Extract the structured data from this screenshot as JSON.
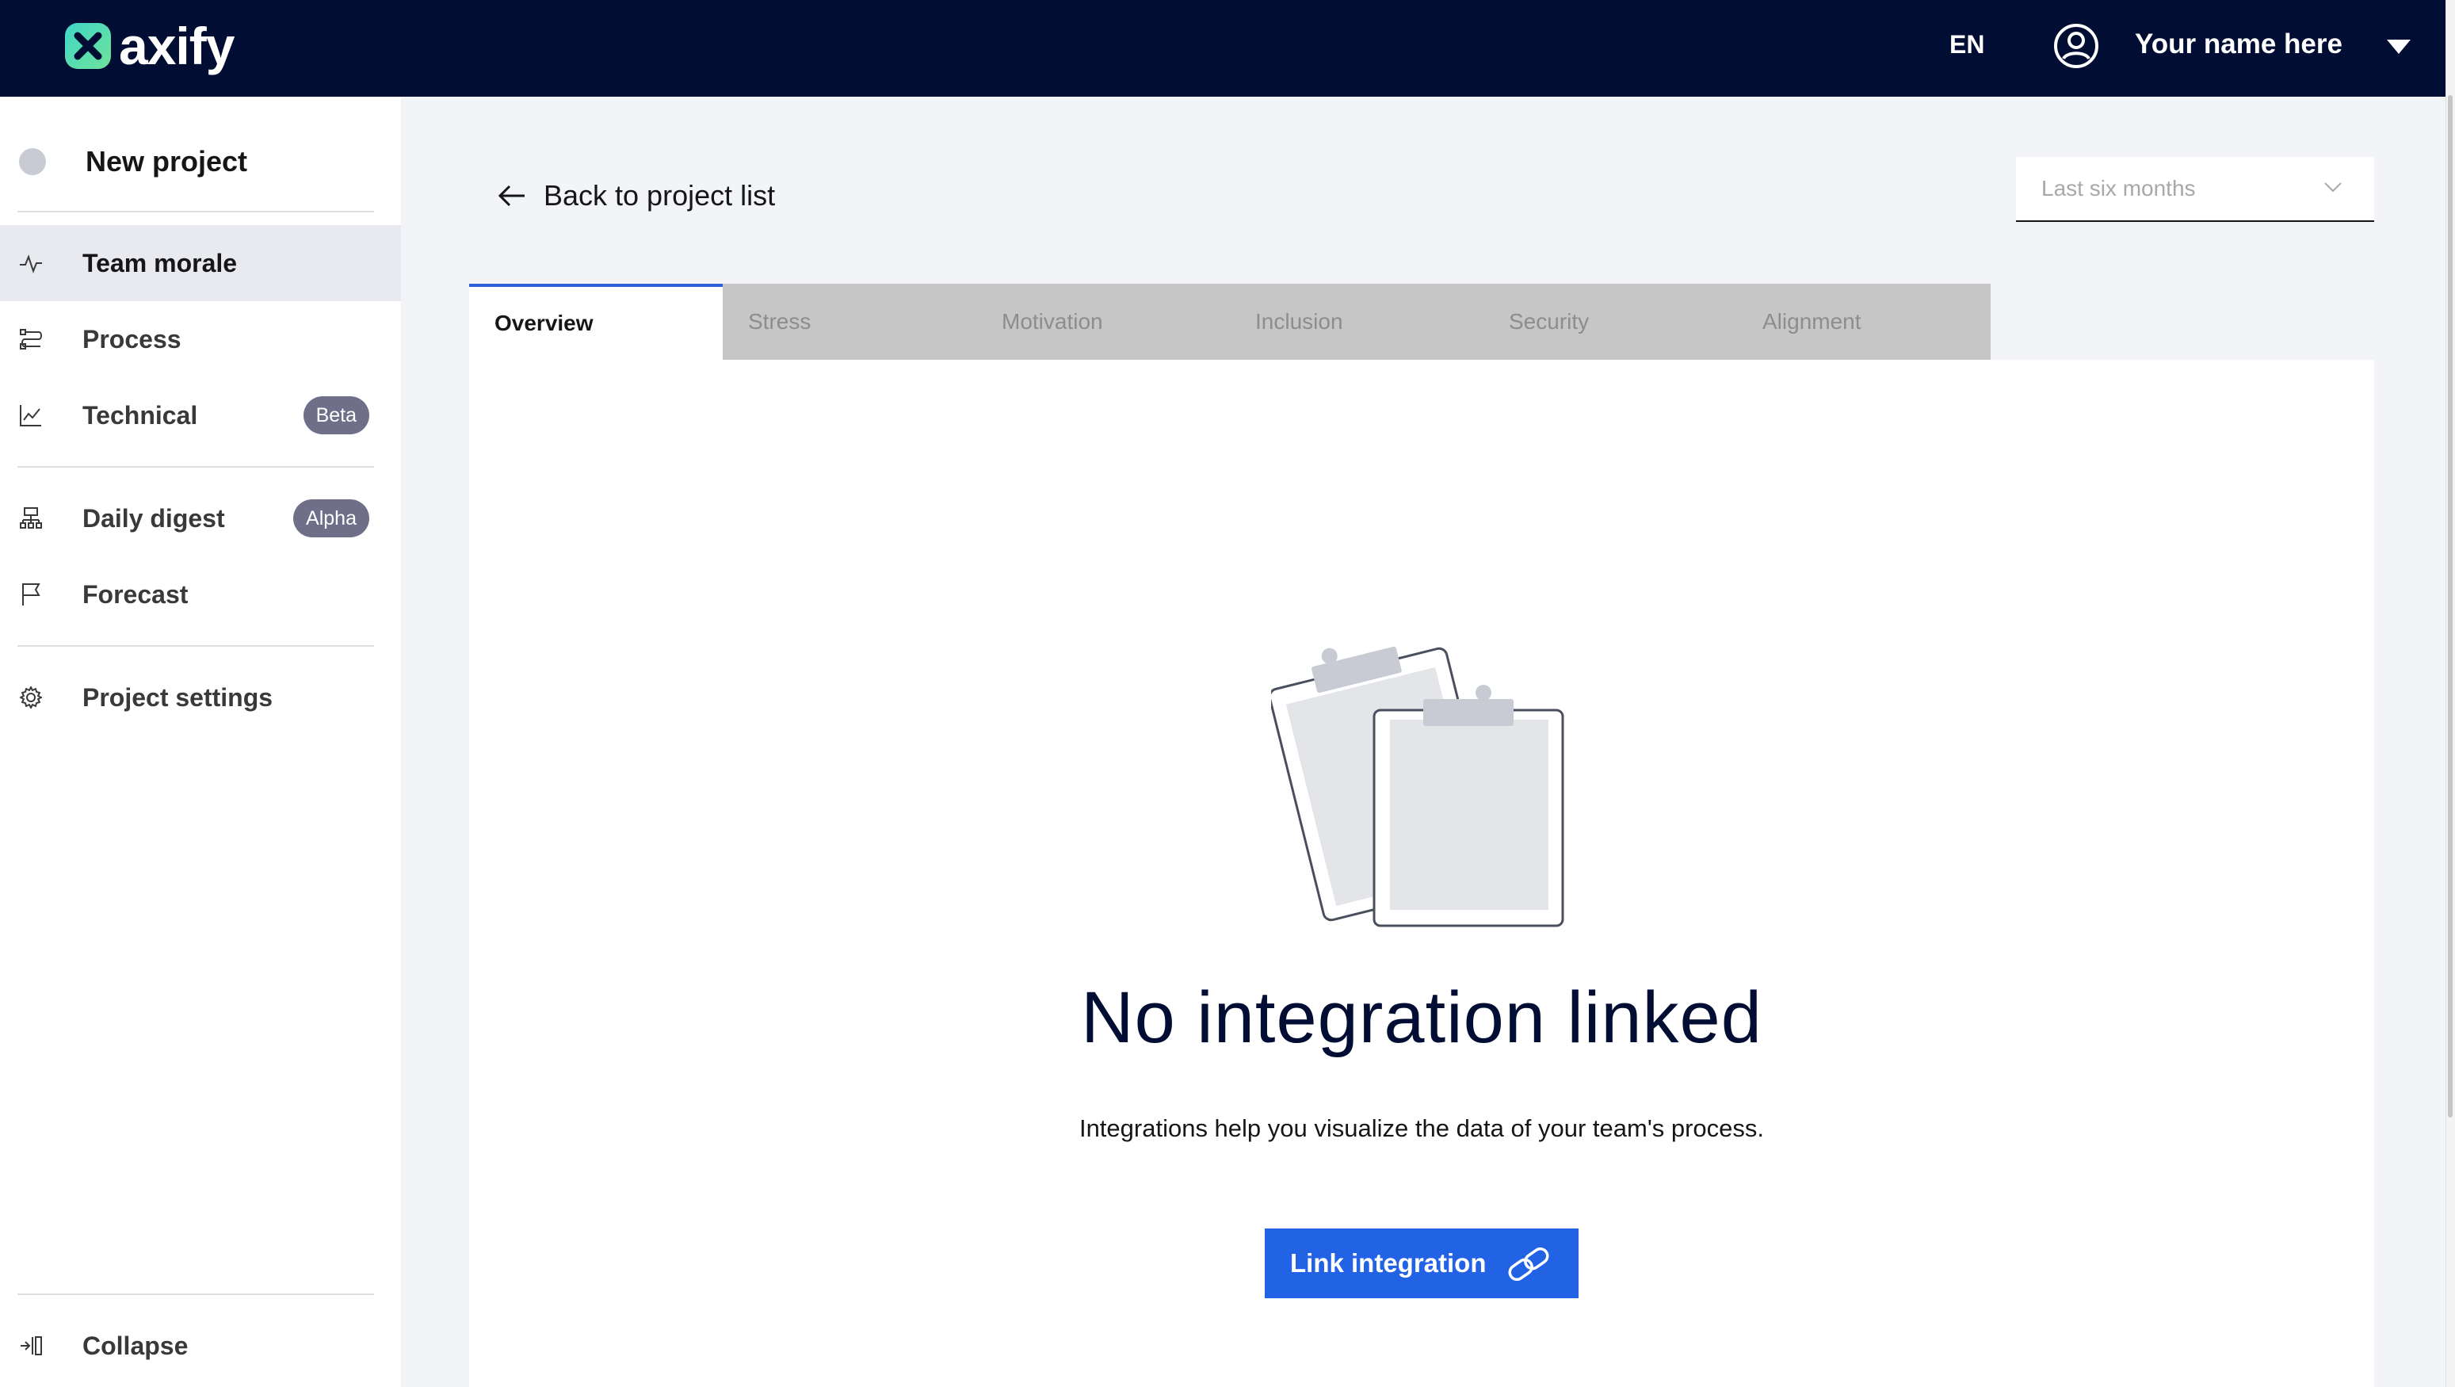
{
  "header": {
    "brand": "axify",
    "language": "EN",
    "user_name": "Your name here"
  },
  "sidebar": {
    "project_name": "New project",
    "items": [
      {
        "label": "Team morale",
        "icon": "pulse-icon",
        "active": true
      },
      {
        "label": "Process",
        "icon": "process-icon"
      },
      {
        "label": "Technical",
        "icon": "line-chart-icon",
        "badge": "Beta"
      },
      {
        "label": "Daily digest",
        "icon": "hierarchy-icon",
        "badge": "Alpha"
      },
      {
        "label": "Forecast",
        "icon": "flag-icon"
      },
      {
        "label": "Project settings",
        "icon": "gear-icon"
      }
    ],
    "collapse_label": "Collapse"
  },
  "main": {
    "back_label": "Back to project list",
    "range_select": {
      "value": "Last six months"
    },
    "tabs": [
      {
        "label": "Overview",
        "active": true
      },
      {
        "label": "Stress"
      },
      {
        "label": "Motivation"
      },
      {
        "label": "Inclusion"
      },
      {
        "label": "Security"
      },
      {
        "label": "Alignment"
      }
    ],
    "empty_state": {
      "title": "No integration linked",
      "description": "Integrations help you visualize the data of your team's process.",
      "button_label": "Link integration"
    }
  },
  "colors": {
    "topbar": "#020d33",
    "accent": "#2262e4",
    "tab_indicator": "#2d5fd6",
    "badge": "#6f6f8a"
  }
}
